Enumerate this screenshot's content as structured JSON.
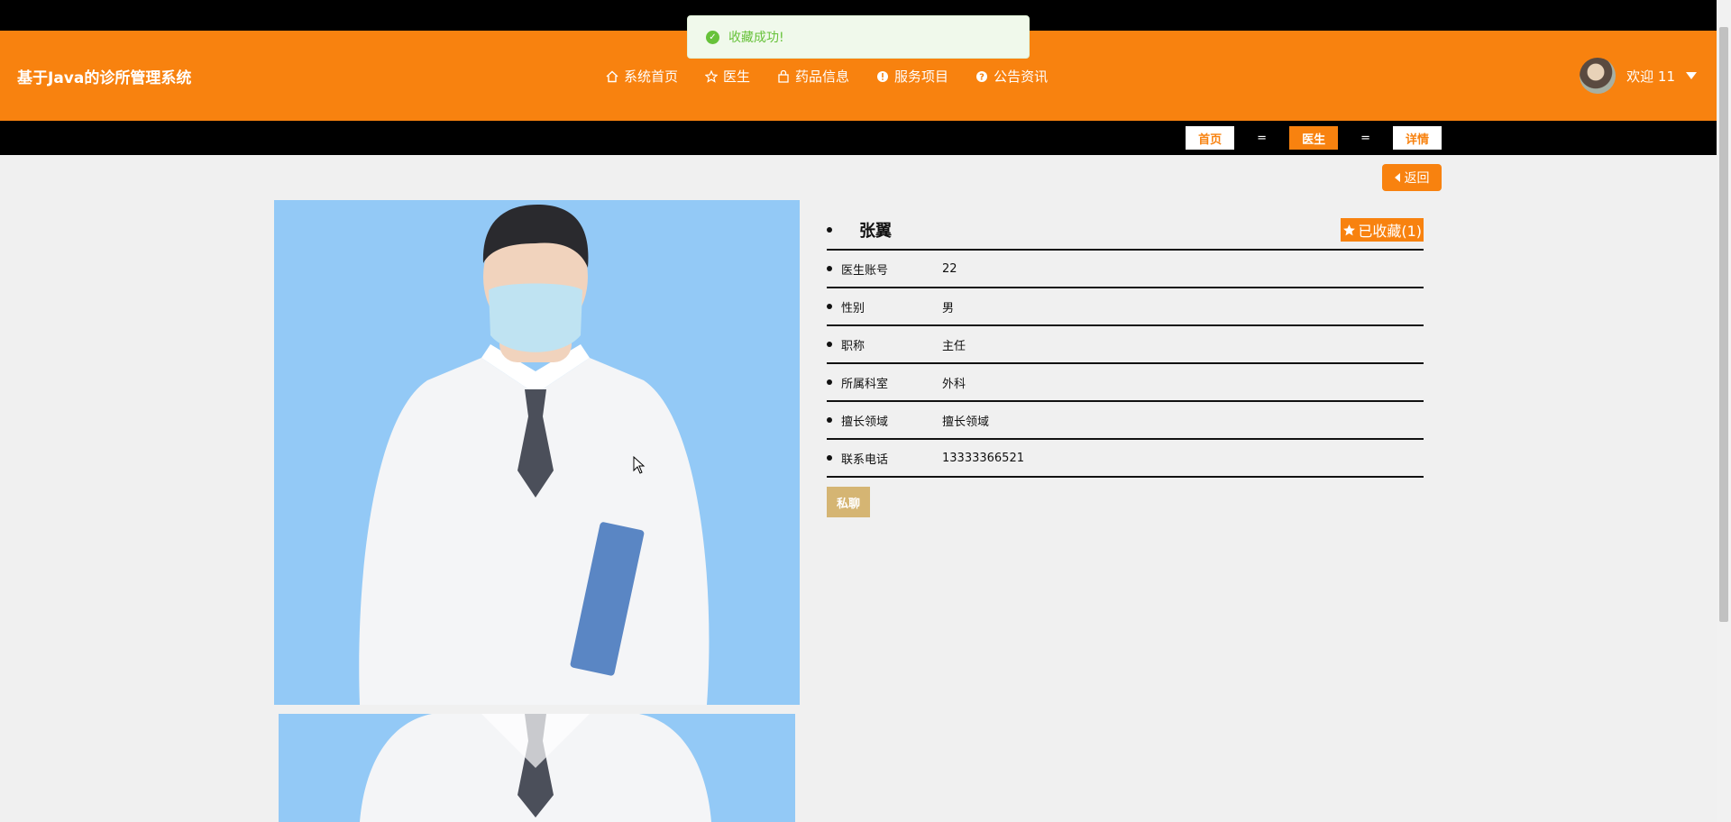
{
  "header": {
    "brand": "基于Java的诊所管理系统",
    "nav": [
      {
        "label": "系统首页",
        "icon": "home-icon"
      },
      {
        "label": "医生",
        "icon": "star-icon"
      },
      {
        "label": "药品信息",
        "icon": "bag-icon"
      },
      {
        "label": "服务项目",
        "icon": "info-icon"
      },
      {
        "label": "公告资讯",
        "icon": "question-icon"
      }
    ],
    "welcome": "欢迎 11"
  },
  "breadcrumb": {
    "items": [
      "首页",
      "医生",
      "详情"
    ],
    "separator": "="
  },
  "toast": {
    "message": "收藏成功!"
  },
  "back_label": "返回",
  "doctor": {
    "name": "张翼",
    "favorite_label": "已收藏(1)",
    "fields": [
      {
        "label": "医生账号",
        "value": "22"
      },
      {
        "label": "性别",
        "value": "男"
      },
      {
        "label": "职称",
        "value": "主任"
      },
      {
        "label": "所属科室",
        "value": "外科"
      },
      {
        "label": "擅长领域",
        "value": "擅长领域"
      },
      {
        "label": "联系电话",
        "value": "13333366521"
      }
    ],
    "chat_label": "私聊"
  },
  "colors": {
    "accent": "#f8820f",
    "photo_bg": "#93c9f6",
    "chat_button": "#d5b573",
    "toast_green": "#67c23a"
  }
}
